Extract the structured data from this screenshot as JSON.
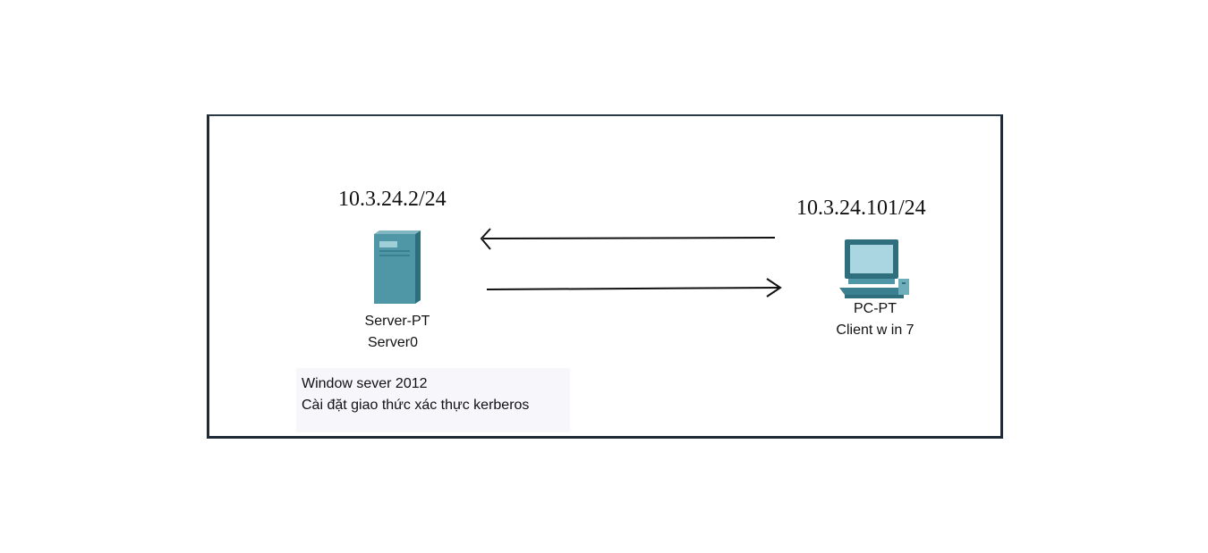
{
  "server": {
    "ip": "10.3.24.2/24",
    "model": "Server-PT",
    "name": "Server0"
  },
  "client": {
    "ip": "10.3.24.101/24",
    "model": "PC-PT",
    "name": "Client w in 7"
  },
  "note": {
    "line1": "Window sever 2012",
    "line2": "Cài đặt giao thức xác thực kerberos"
  },
  "colors": {
    "border": "#1e2a35",
    "device_teal": "#4f97a6",
    "note_bg": "#f6f6fb"
  }
}
